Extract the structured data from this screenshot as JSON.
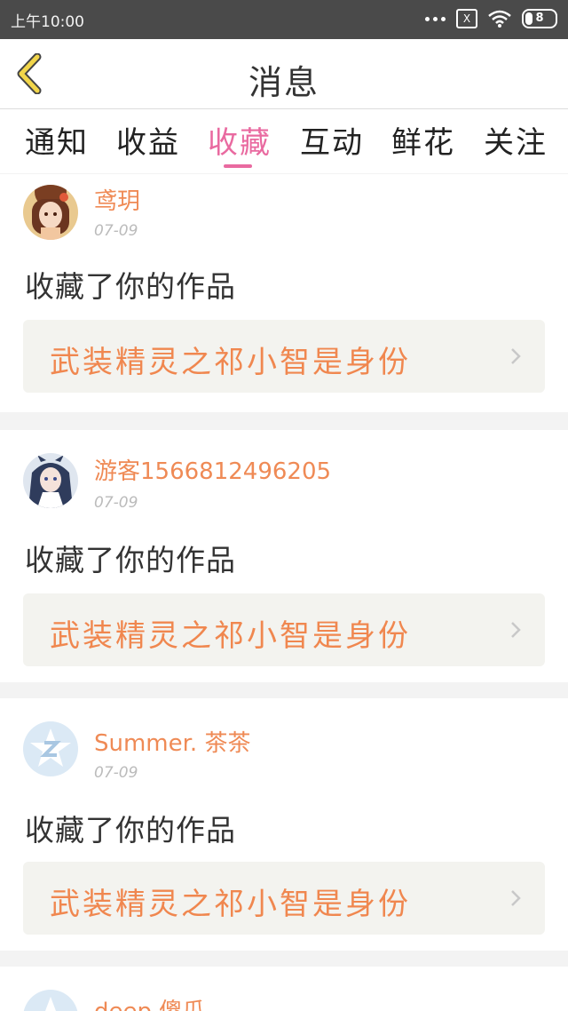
{
  "status_bar": {
    "time": "上午10:00",
    "sim_label": "X",
    "battery": "8"
  },
  "header": {
    "title": "消息"
  },
  "tabs": [
    {
      "label": "通知",
      "active": false
    },
    {
      "label": "收益",
      "active": false
    },
    {
      "label": "收藏",
      "active": true
    },
    {
      "label": "互动",
      "active": false
    },
    {
      "label": "鲜花",
      "active": false
    },
    {
      "label": "关注",
      "active": false
    }
  ],
  "messages": [
    {
      "user": "鸢玥",
      "date": "07-09",
      "action": "收藏了你的作品",
      "work": "武装精灵之祁小智是身份",
      "avatar": "anime-avatar-brown-hair"
    },
    {
      "user": "游客1566812496205",
      "date": "07-09",
      "action": "收藏了你的作品",
      "work": "武装精灵之祁小智是身份",
      "avatar": "anime-avatar-blue-dress"
    },
    {
      "user": "Summer. 茶茶",
      "date": "07-09",
      "action": "收藏了你的作品",
      "work": "武装精灵之祁小智是身份",
      "avatar": "default-star-avatar"
    },
    {
      "user": "deep 傻瓜",
      "date": "",
      "action": "",
      "work": "",
      "avatar": "default-star-avatar"
    }
  ],
  "colors": {
    "accent_pink": "#e96aa0",
    "name_orange": "#ef8a55",
    "back_yellow": "#f2d64a"
  }
}
